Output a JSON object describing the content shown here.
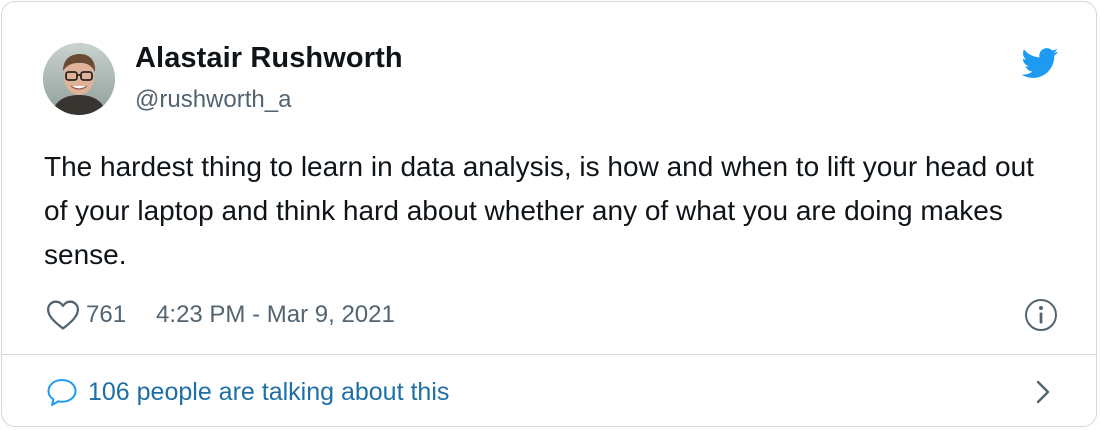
{
  "author": {
    "name": "Alastair Rushworth",
    "handle": "@rushworth_a"
  },
  "tweet": {
    "text": "The hardest thing to learn in data analysis, is how and when to lift your head out of your laptop and think hard about whether any of what you are doing makes sense.",
    "likes": "761",
    "timestamp": "4:23 PM - Mar 9, 2021"
  },
  "conversation": {
    "label": "106 people are talking about this"
  },
  "icons": {
    "brand": "twitter-bird-icon",
    "like": "heart-icon",
    "info": "info-icon",
    "reply": "speech-bubble-icon",
    "more": "chevron-right-icon"
  },
  "colors": {
    "brand": "#1d9bf0",
    "link": "#1d6fa5",
    "text": "#0f1419",
    "secondary": "#536471",
    "border": "#cfd9de"
  }
}
